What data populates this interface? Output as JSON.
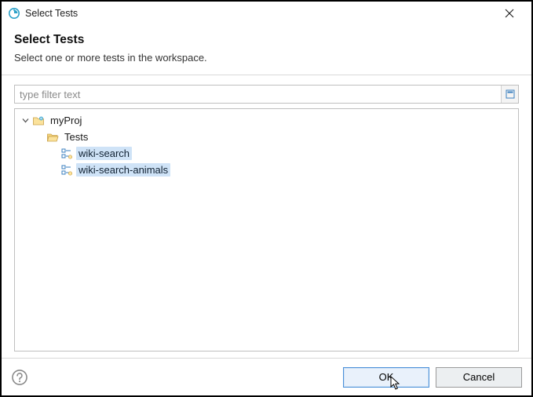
{
  "window": {
    "title": "Select Tests"
  },
  "header": {
    "heading": "Select Tests",
    "subtitle": "Select one or more tests in the workspace."
  },
  "filter": {
    "placeholder": "type filter text",
    "value": ""
  },
  "tree": {
    "root": {
      "label": "myProj",
      "expanded": true,
      "children": {
        "tests": {
          "label": "Tests",
          "expanded": true,
          "items": [
            {
              "label": "wiki-search",
              "selected": true
            },
            {
              "label": "wiki-search-animals",
              "selected": true
            }
          ]
        }
      }
    }
  },
  "buttons": {
    "ok": "OK",
    "cancel": "Cancel"
  }
}
